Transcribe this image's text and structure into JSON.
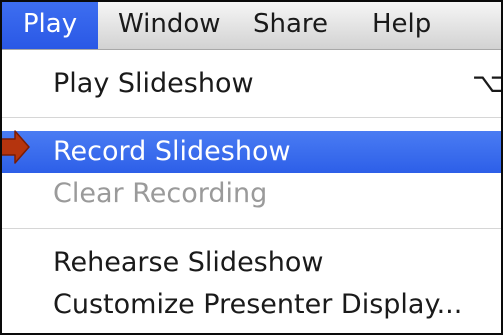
{
  "menubar": {
    "items": [
      {
        "label": "Play"
      },
      {
        "label": "Window"
      },
      {
        "label": "Share"
      },
      {
        "label": "Help"
      }
    ]
  },
  "menu": {
    "items": [
      {
        "label": "Play Slideshow",
        "shortcut": "⌥⌘"
      },
      {
        "label": "Record Slideshow"
      },
      {
        "label": "Clear Recording"
      },
      {
        "label": "Rehearse Slideshow"
      },
      {
        "label": "Customize Presenter Display..."
      }
    ]
  },
  "colors": {
    "highlight": "#2d5fe8",
    "disabled_text": "#9a9a9a",
    "pointer_arrow": "#b5340e"
  },
  "icons": {
    "pointer": "red-arrow-icon"
  }
}
